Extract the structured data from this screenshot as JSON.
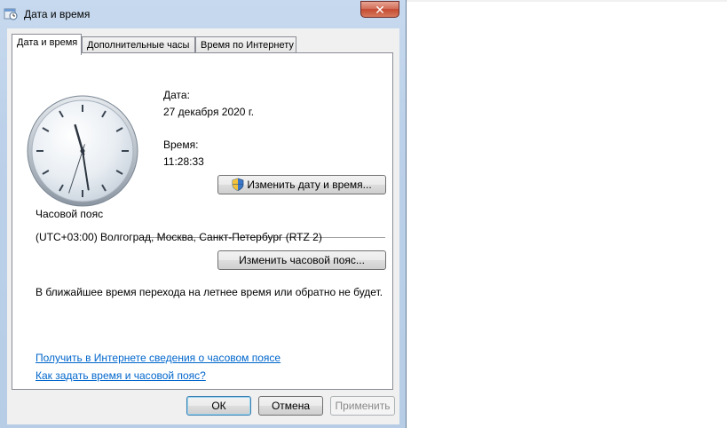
{
  "window": {
    "title": "Дата и время",
    "close_label": "✕"
  },
  "tabs": [
    {
      "label": "Дата и время",
      "active": true
    },
    {
      "label": "Дополнительные часы",
      "active": false
    },
    {
      "label": "Время по Интернету",
      "active": false
    }
  ],
  "date_section": {
    "date_label": "Дата:",
    "date_value": "27 декабря 2020 г.",
    "time_label": "Время:",
    "time_value": "11:28:33",
    "change_button": "Изменить дату и время..."
  },
  "clock": {
    "hour": 11,
    "minute": 28,
    "second": 33
  },
  "timezone_section": {
    "heading": "Часовой пояс",
    "value": "(UTC+03:00) Волгоград, Москва, Санкт-Петербург (RTZ 2)",
    "change_button": "Изменить часовой пояс...",
    "dst_note": "В ближайшее время перехода на летнее время или обратно не будет."
  },
  "links": {
    "online_info": "Получить в Интернете сведения о часовом поясе",
    "how_to": "Как задать время и часовой пояс?"
  },
  "footer": {
    "ok": "ОК",
    "cancel": "Отмена",
    "apply": "Применить"
  }
}
